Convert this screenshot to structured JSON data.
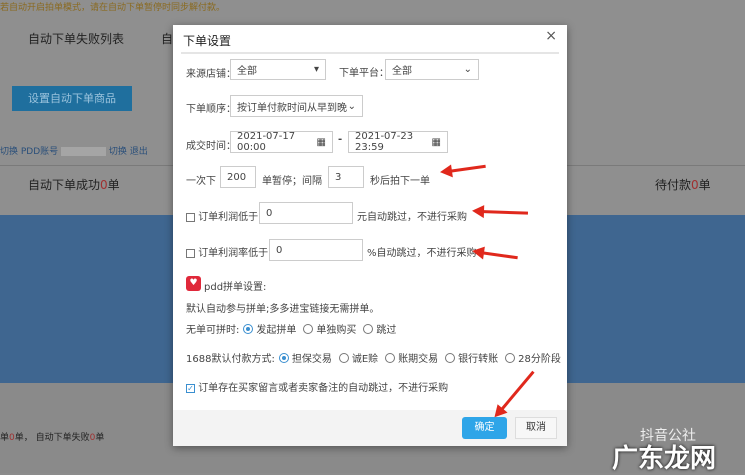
{
  "background": {
    "notice": "若自动开启拍单模式，请在自动下单暂停时同步解付款。",
    "tabs": [
      "自动下单失败列表",
      "自"
    ],
    "set_button": "设置自动下单商品",
    "account": {
      "prefix": "切换 PDD账号",
      "switch": "切换",
      "logout": "退出"
    },
    "stats": {
      "success_label": "自动下单成功",
      "success_count": "0",
      "unit": "单",
      "pending_label": "待付款",
      "pending_count": "0"
    },
    "bottom": {
      "text1": "单",
      "count1": "0",
      "text2": "单， 自动下单失败",
      "count2": "0",
      "text3": "单"
    }
  },
  "modal": {
    "title": "下单设置",
    "close": "×",
    "source_shop": {
      "label": "来源店铺：",
      "value": "全部"
    },
    "platform": {
      "label": "下单平台：",
      "value": "全部"
    },
    "order_sequence": {
      "label": "下单顺序：",
      "value": "按订单付款时间从早到晚"
    },
    "deal_time": {
      "label": "成交时间：",
      "start": "2021-07-17 00:00",
      "sep": "-",
      "end": "2021-07-23 23:59"
    },
    "batch": {
      "prefix": "一次下",
      "count": "200",
      "middle": "单暂停；间隔",
      "interval": "3",
      "suffix": "秒后拍下一单"
    },
    "profit_min": {
      "checked": false,
      "label": "订单利润低于",
      "value": "0",
      "suffix": "元自动跳过，不进行采购"
    },
    "profit_rate_min": {
      "checked": false,
      "label": "订单利润率低于",
      "value": "0",
      "suffix": "%自动跳过，不进行采购"
    },
    "pdd": {
      "title": "pdd拼单设置:",
      "desc": "默认自动参与拼单;多多进宝链接无需拼单。",
      "no_group_label": "无单可拼时:",
      "no_group_options": [
        "发起拼单",
        "单独购买",
        "跳过"
      ],
      "no_group_selected": 0
    },
    "payment": {
      "label": "1688默认付款方式:",
      "options": [
        "担保交易",
        "诚E赊",
        "账期交易",
        "银行转账",
        "28分阶段"
      ],
      "selected": 0
    },
    "skip_remark": {
      "checked": true,
      "label": "订单存在买家留言或者卖家备注的自动跳过，不进行采购"
    },
    "ok": "确定",
    "cancel": "取消"
  },
  "watermark": {
    "line1": "抖音公社",
    "line2": "广东龙网"
  },
  "colors": {
    "accent": "#2ea5e8",
    "arrow": "#e0281c"
  }
}
